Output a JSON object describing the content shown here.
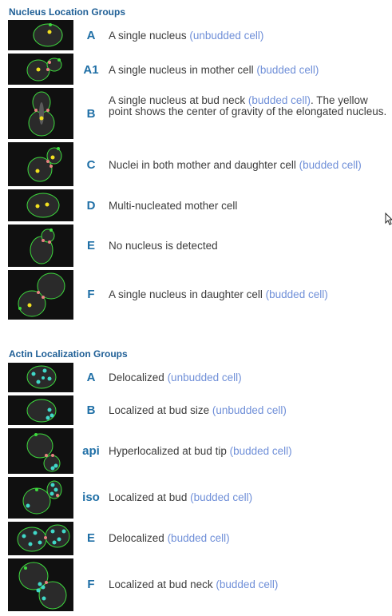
{
  "nucleus_section": {
    "title": "Nucleus Location Groups",
    "items": [
      {
        "code": "A",
        "text": "A single nucleus",
        "note": "(unbudded cell)",
        "after": ""
      },
      {
        "code": "A1",
        "text": "A single nucleus in mother cell",
        "note": "(budded cell)",
        "after": ""
      },
      {
        "code": "B",
        "text": "A single nucleus at bud neck",
        "note": "(budded cell)",
        "after": ". The yellow point shows the center of gravity of the elongated nucleus."
      },
      {
        "code": "C",
        "text": "Nuclei in both mother and daughter cell",
        "note": "(budded cell)",
        "after": ""
      },
      {
        "code": "D",
        "text": "Multi-nucleated mother cell",
        "note": "",
        "after": ""
      },
      {
        "code": "E",
        "text": "No nucleus is detected",
        "note": "",
        "after": ""
      },
      {
        "code": "F",
        "text": "A single nucleus in daughter cell",
        "note": "(budded cell)",
        "after": ""
      }
    ]
  },
  "actin_section": {
    "title": "Actin Localization Groups",
    "items": [
      {
        "code": "A",
        "text": "Delocalized",
        "note": "(unbudded cell)",
        "after": ""
      },
      {
        "code": "B",
        "text": "Localized at bud size",
        "note": "(unbudded cell)",
        "after": ""
      },
      {
        "code": "api",
        "text": "Hyperlocalized at bud tip",
        "note": "(budded cell)",
        "after": ""
      },
      {
        "code": "iso",
        "text": "Localized at bud",
        "note": "(budded cell)",
        "after": ""
      },
      {
        "code": "E",
        "text": "Delocalized",
        "note": "(budded cell)",
        "after": ""
      },
      {
        "code": "F",
        "text": "Localized at bud neck",
        "note": "(budded cell)",
        "after": ""
      }
    ]
  },
  "colors": {
    "title": "#1f5f96",
    "code": "#1f6fa6",
    "note": "#6f8fd8",
    "cell_outline": "#3ddc3d",
    "nucleus_point": "#f2e020",
    "neck_point": "#e88080",
    "actin_patch": "#40d8c8"
  },
  "icons": {
    "cursor": "mouse-pointer-icon"
  }
}
